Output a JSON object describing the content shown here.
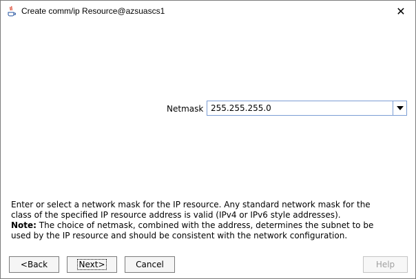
{
  "window": {
    "title": "Create comm/ip Resource@azsuascs1",
    "close_glyph": "✕"
  },
  "form": {
    "netmask_label": "Netmask",
    "netmask_value": "255.255.255.0"
  },
  "help": {
    "line1": "Enter or select a network mask for the IP resource. Any standard network mask for the",
    "line2": "class of the specified IP resource address is valid (IPv4 or IPv6 style addresses).",
    "note_label": "Note:",
    "line3": " The choice of netmask, combined with the address, determines the subnet to be",
    "line4": "used by the IP resource and should be consistent with the network configuration."
  },
  "buttons": {
    "back": "<Back",
    "next": "Next>",
    "cancel": "Cancel",
    "help": "Help"
  },
  "icons": {
    "app": "java-coffee-cup-icon",
    "dropdown": "chevron-down-icon"
  }
}
